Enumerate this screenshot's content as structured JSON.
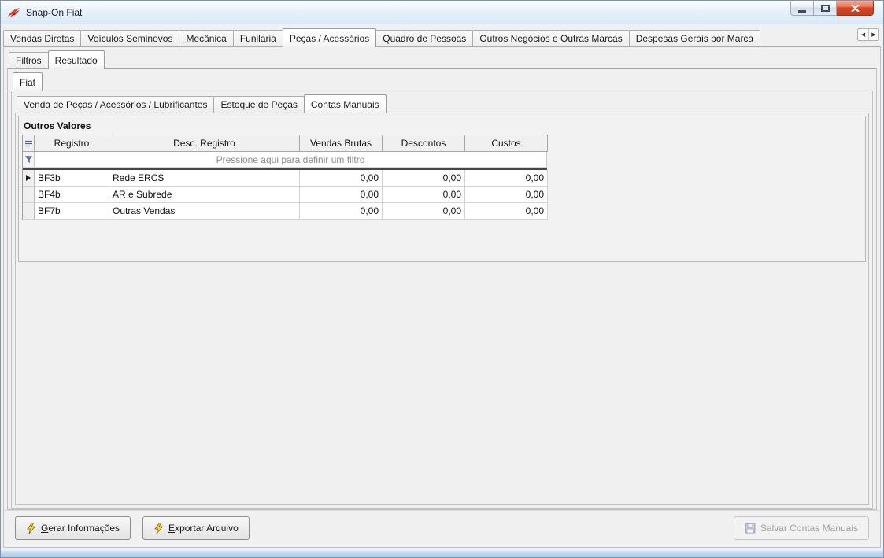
{
  "window": {
    "title": "Snap-On Fiat"
  },
  "colors": {
    "chrome_blue": "#ACCBE9",
    "close_button_red": "#D4482A",
    "filter_text_gray": "#8C8C8C",
    "grid_separator_dark": "#454545",
    "background_gray": "#F0F0F0"
  },
  "icons": {
    "app_logo": "snapon-wing",
    "minimize": "minimize-bar",
    "maximize": "maximize-square",
    "close": "close-x",
    "tab_scroll_left": "◀",
    "tab_scroll_right": "▶",
    "grid_options": "grid-lines",
    "filter": "funnel",
    "current_row": "triangle-right",
    "generate": "lightning-bolt",
    "export": "lightning-bolt",
    "save": "diskette"
  },
  "tabs_main": {
    "selected_index": 4,
    "items": [
      "Vendas Diretas",
      "Veículos Seminovos",
      "Mecânica",
      "Funilaria",
      "Peças / Acessórios",
      "Quadro de Pessoas",
      "Outros Negócios e Outras Marcas",
      "Despesas Gerais por Marca"
    ]
  },
  "tabs_view": {
    "selected_index": 1,
    "items": [
      "Filtros",
      "Resultado"
    ]
  },
  "tabs_brand": {
    "selected_index": 0,
    "items": [
      "Fiat"
    ]
  },
  "tabs_section": {
    "selected_index": 2,
    "items": [
      "Venda de Peças / Acessórios / Lubrificantes",
      "Estoque de Peças",
      "Contas Manuais"
    ]
  },
  "group": {
    "title": "Outros Valores"
  },
  "grid": {
    "columns": [
      "Registro",
      "Desc. Registro",
      "Vendas Brutas",
      "Descontos",
      "Custos"
    ],
    "filter_prompt": "Pressione aqui para definir um filtro",
    "rows": [
      {
        "registro": "BF3b",
        "descricao": "Rede ERCS",
        "vendas_brutas": "0,00",
        "descontos": "0,00",
        "custos": "0,00"
      },
      {
        "registro": "BF4b",
        "descricao": "AR e Subrede",
        "vendas_brutas": "0,00",
        "descontos": "0,00",
        "custos": "0,00"
      },
      {
        "registro": "BF7b",
        "descricao": "Outras Vendas",
        "vendas_brutas": "0,00",
        "descontos": "0,00",
        "custos": "0,00"
      }
    ]
  },
  "actions": {
    "generate": {
      "accel": "G",
      "rest": "erar Informações"
    },
    "export": {
      "accel": "E",
      "rest": "xportar Arquivo"
    },
    "save": {
      "label": "Salvar Contas Manuais",
      "enabled": false
    }
  }
}
